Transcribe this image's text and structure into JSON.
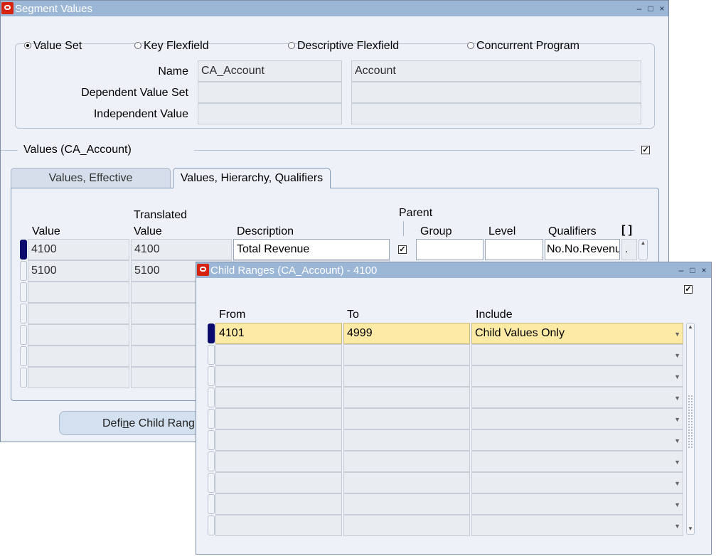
{
  "main_window": {
    "title": "Segment Values",
    "controls": [
      "–",
      "□",
      "×"
    ],
    "radios": [
      {
        "label": "Value Set",
        "selected": true
      },
      {
        "label": "Key Flexfield",
        "selected": false
      },
      {
        "label": "Descriptive Flexfield",
        "selected": false
      },
      {
        "label": "Concurrent Program",
        "selected": false
      }
    ],
    "fields": {
      "name_label": "Name",
      "name_value": "CA_Account",
      "name_desc": "Account",
      "dependent_label": "Dependent Value Set",
      "dependent_value": "",
      "dependent_desc": "",
      "independent_label": "Independent Value",
      "independent_value": "",
      "independent_desc": ""
    },
    "values_section": {
      "title": "Values (CA_Account)",
      "checked": true
    },
    "tabs": [
      {
        "label": "Values, Effective",
        "active": false
      },
      {
        "label": "Values, Hierarchy, Qualifiers",
        "active": true
      }
    ],
    "headers": {
      "value": "Value",
      "translated_top": "Translated",
      "translated_bottom": "Value",
      "description": "Description",
      "parent": "Parent",
      "group": "Group",
      "level": "Level",
      "qualifiers": "Qualifiers",
      "folder": "[ ]"
    },
    "rows": [
      {
        "value": "4100",
        "translated": "4100",
        "description": "Total Revenue",
        "parent": true,
        "group": "",
        "level": "",
        "qualifiers": "No.No.Revenu",
        "extra": "."
      },
      {
        "value": "5100",
        "translated": "5100",
        "description": "",
        "parent": false,
        "group": "",
        "level": "",
        "qualifiers": "",
        "extra": ""
      },
      {
        "value": "",
        "translated": "",
        "description": "",
        "parent": false,
        "group": "",
        "level": "",
        "qualifiers": "",
        "extra": ""
      },
      {
        "value": "",
        "translated": "",
        "description": "",
        "parent": false,
        "group": "",
        "level": "",
        "qualifiers": "",
        "extra": ""
      },
      {
        "value": "",
        "translated": "",
        "description": "",
        "parent": false,
        "group": "",
        "level": "",
        "qualifiers": "",
        "extra": ""
      },
      {
        "value": "",
        "translated": "",
        "description": "",
        "parent": false,
        "group": "",
        "level": "",
        "qualifiers": "",
        "extra": ""
      },
      {
        "value": "",
        "translated": "",
        "description": "",
        "parent": false,
        "group": "",
        "level": "",
        "qualifiers": "",
        "extra": ""
      }
    ],
    "define_button": {
      "pre": "Defi",
      "mnemonic": "n",
      "post": "e Child Rang"
    }
  },
  "child_window": {
    "title": "Child Ranges (CA_Account) - 4100",
    "controls": [
      "–",
      "□",
      "×"
    ],
    "checked": true,
    "headers": {
      "from": "From",
      "to": "To",
      "include": "Include"
    },
    "rows": [
      {
        "from": "4101",
        "to": "4999",
        "include": "Child Values Only"
      },
      {
        "from": "",
        "to": "",
        "include": ""
      },
      {
        "from": "",
        "to": "",
        "include": ""
      },
      {
        "from": "",
        "to": "",
        "include": ""
      },
      {
        "from": "",
        "to": "",
        "include": ""
      },
      {
        "from": "",
        "to": "",
        "include": ""
      },
      {
        "from": "",
        "to": "",
        "include": ""
      },
      {
        "from": "",
        "to": "",
        "include": ""
      },
      {
        "from": "",
        "to": "",
        "include": ""
      },
      {
        "from": "",
        "to": "",
        "include": ""
      }
    ],
    "scroll_up": "▲",
    "scroll_down": "▼"
  },
  "colors": {
    "titlebar": "#9cb6d6",
    "window_bg": "#eef2f8",
    "current_record": "#fdeba5",
    "row_indicator": "#0b0b6d",
    "app_icon": "#d6230f"
  }
}
